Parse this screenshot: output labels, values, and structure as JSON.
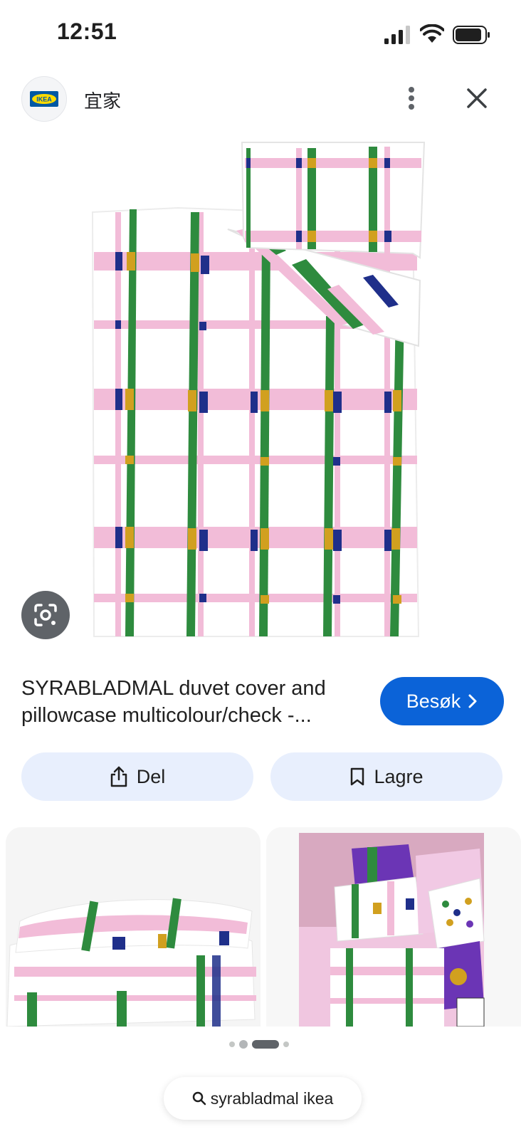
{
  "status_bar": {
    "time": "12:51"
  },
  "header": {
    "site_name": "宜家",
    "logo_text": "IKEA"
  },
  "product": {
    "title_line1": "SYRABLADMAL duvet cover and",
    "title_line2": "pillowcase multicolour/check -..."
  },
  "buttons": {
    "visit": "Besøk",
    "share": "Del",
    "save": "Lagre"
  },
  "pagination": {
    "total": 4,
    "active_index": 2
  },
  "search": {
    "query": "syrabladmal ikea"
  },
  "colors": {
    "accent": "#0b63d8",
    "chip_bg": "#e8effd",
    "stripe_pink": "#f2bcd8",
    "stripe_green": "#2e8b3e",
    "stripe_navy": "#1f2f8a",
    "stripe_mustard": "#d1a01f"
  },
  "icons": [
    "signal-icon",
    "wifi-icon",
    "battery-icon",
    "more-vertical-icon",
    "close-icon",
    "lens-icon",
    "share-icon",
    "bookmark-icon",
    "chevron-right-icon",
    "search-icon"
  ]
}
